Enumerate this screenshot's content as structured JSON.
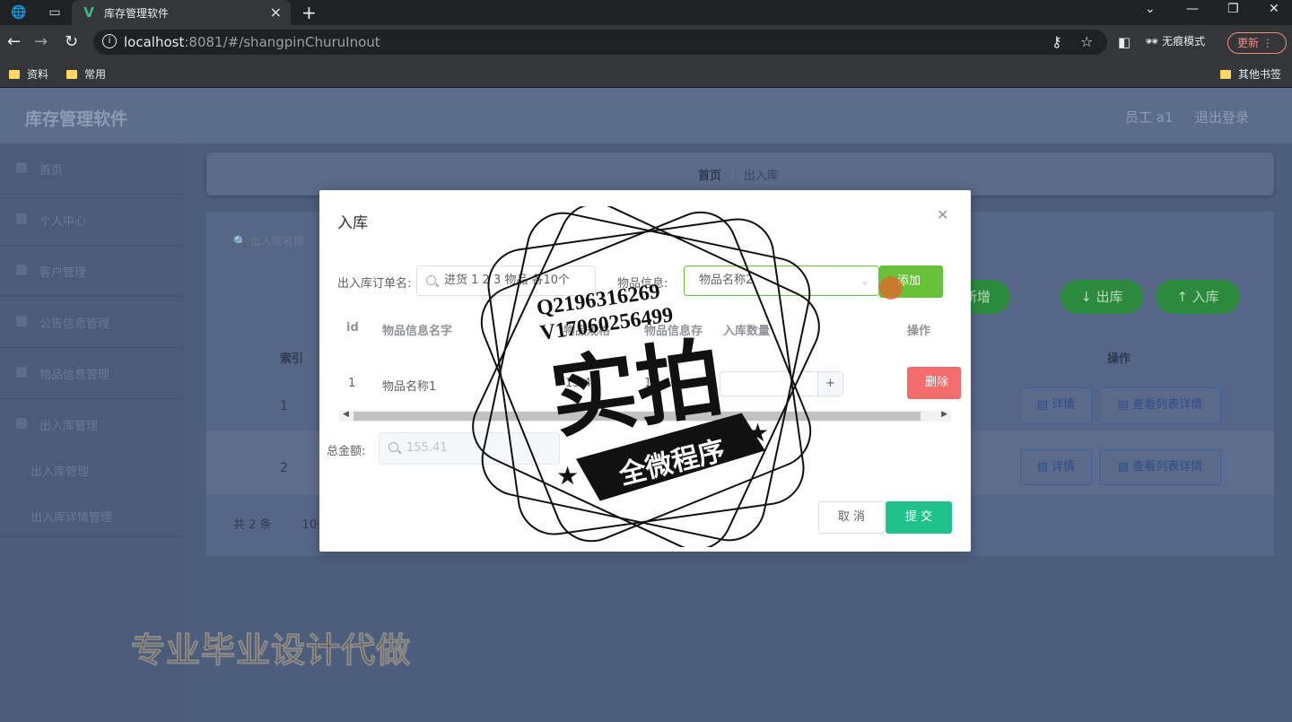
{
  "browser": {
    "tab_title": "库存管理软件",
    "url_host": "localhost",
    "url_rest": ":8081/#/shangpinChuruInout",
    "incognito_label": "无痕模式",
    "update_label": "更新",
    "bookmarks": [
      "资料",
      "常用"
    ],
    "other_bookmarks": "其他书签"
  },
  "header": {
    "title": "库存管理软件",
    "user": "员工 a1",
    "logout": "退出登录"
  },
  "sidebar": {
    "items": [
      {
        "label": "首页"
      },
      {
        "label": "个人中心"
      },
      {
        "label": "客户管理"
      },
      {
        "label": "公告信息管理"
      },
      {
        "label": "物品信息管理"
      },
      {
        "label": "出入库管理"
      }
    ],
    "subitems": [
      {
        "label": "出入库管理"
      },
      {
        "label": "出入库详情管理"
      }
    ]
  },
  "breadcrumb": {
    "home": "首页",
    "separator": "/",
    "current": "出入库"
  },
  "list": {
    "search_placeholder": "出入库名称",
    "btn_new": "新增",
    "btn_out": "出库",
    "btn_in": "入库",
    "col_index": "索引",
    "col_action": "操作",
    "rows": [
      {
        "index": "1"
      },
      {
        "index": "2"
      }
    ],
    "btn_detail": "详情",
    "btn_list_detail": "查看列表详情",
    "total_text": "共 2 条",
    "page_size_text": "10条"
  },
  "dialog": {
    "title": "入库",
    "order_label": "出入库订单名:",
    "order_value": "进货 1 2 3 物品 各10个",
    "goods_label": "物品信息:",
    "goods_value": "物品名称2",
    "add_button": "添加",
    "columns": {
      "id": "id",
      "name": "物品信息名字",
      "spec": "物品规格",
      "stock": "物品信息存",
      "qty": "入库数量",
      "action": "操作"
    },
    "rows": [
      {
        "id": "1",
        "name": "物品名称1",
        "spec": "15.4",
        "stock": "1"
      }
    ],
    "delete_button": "删除",
    "total_label": "总金额:",
    "total_value": "155.41",
    "cancel_button": "取 消",
    "submit_button": "提 交"
  },
  "watermark": {
    "line1": "Q2196316269",
    "line2": "V17060256499",
    "big": "实拍",
    "banner": "全微程序"
  },
  "promo": "专业毕业设计代做"
}
